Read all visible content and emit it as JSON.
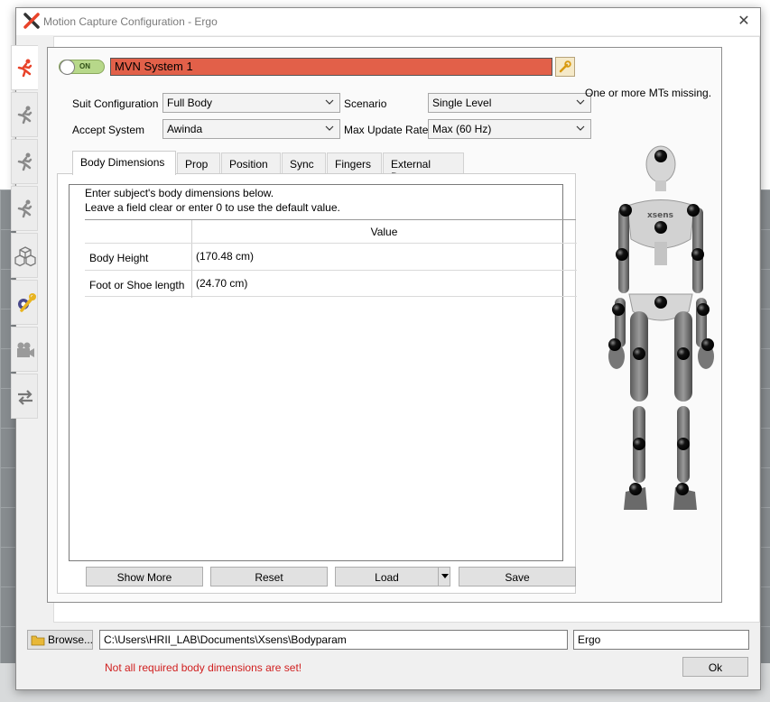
{
  "window": {
    "title": "Motion Capture Configuration - Ergo",
    "close_label": "✕"
  },
  "leftnav": {
    "items": [
      {
        "icon": "running-figure-icon",
        "active": true
      },
      {
        "icon": "running-figure-icon",
        "active": false
      },
      {
        "icon": "running-figure-icon",
        "active": false
      },
      {
        "icon": "running-figure-icon",
        "active": false
      },
      {
        "icon": "cubes-icon",
        "active": false
      },
      {
        "icon": "wrench-settings-icon",
        "active": false
      },
      {
        "icon": "camera-icon",
        "active": false
      },
      {
        "icon": "sync-arrows-icon",
        "active": false
      }
    ]
  },
  "header": {
    "toggle_label": "ON",
    "system_name": "MVN System 1"
  },
  "settings": {
    "suit_config_label": "Suit Configuration",
    "suit_config_value": "Full Body",
    "scenario_label": "Scenario",
    "scenario_value": "Single Level",
    "accept_system_label": "Accept System",
    "accept_system_value": "Awinda",
    "max_rate_label": "Max Update Rate",
    "max_rate_value": "Max (60 Hz)",
    "warning": "One or more MTs missing."
  },
  "tabs": [
    {
      "label": "Body Dimensions"
    },
    {
      "label": "Prop"
    },
    {
      "label": "Position"
    },
    {
      "label": "Sync"
    },
    {
      "label": "Fingers"
    },
    {
      "label": "External Data"
    }
  ],
  "body_dimensions": {
    "instruction_line1": "Enter subject's body dimensions below.",
    "instruction_line2": "Leave a field clear or enter 0 to use the default value.",
    "value_header": "Value",
    "rows": [
      {
        "label": "Body Height",
        "value": "(170.48 cm)"
      },
      {
        "label": "Foot or Shoe length",
        "value": "(24.70 cm)"
      }
    ],
    "buttons": {
      "show_more": "Show More",
      "reset": "Reset",
      "load": "Load",
      "save": "Save"
    }
  },
  "figure": {
    "brand_text": "xsens"
  },
  "footer": {
    "browse_label": "Browse...",
    "path_value": "C:\\Users\\HRII_LAB\\Documents\\Xsens\\Bodyparam",
    "name_value": "Ergo",
    "error_text": "Not all required body dimensions are set!",
    "ok_label": "Ok"
  },
  "colors": {
    "accent_active": "#e8432a",
    "system_name_bg": "#e26049",
    "error": "#d01f1f",
    "toggle_on": "#b7d88a"
  }
}
